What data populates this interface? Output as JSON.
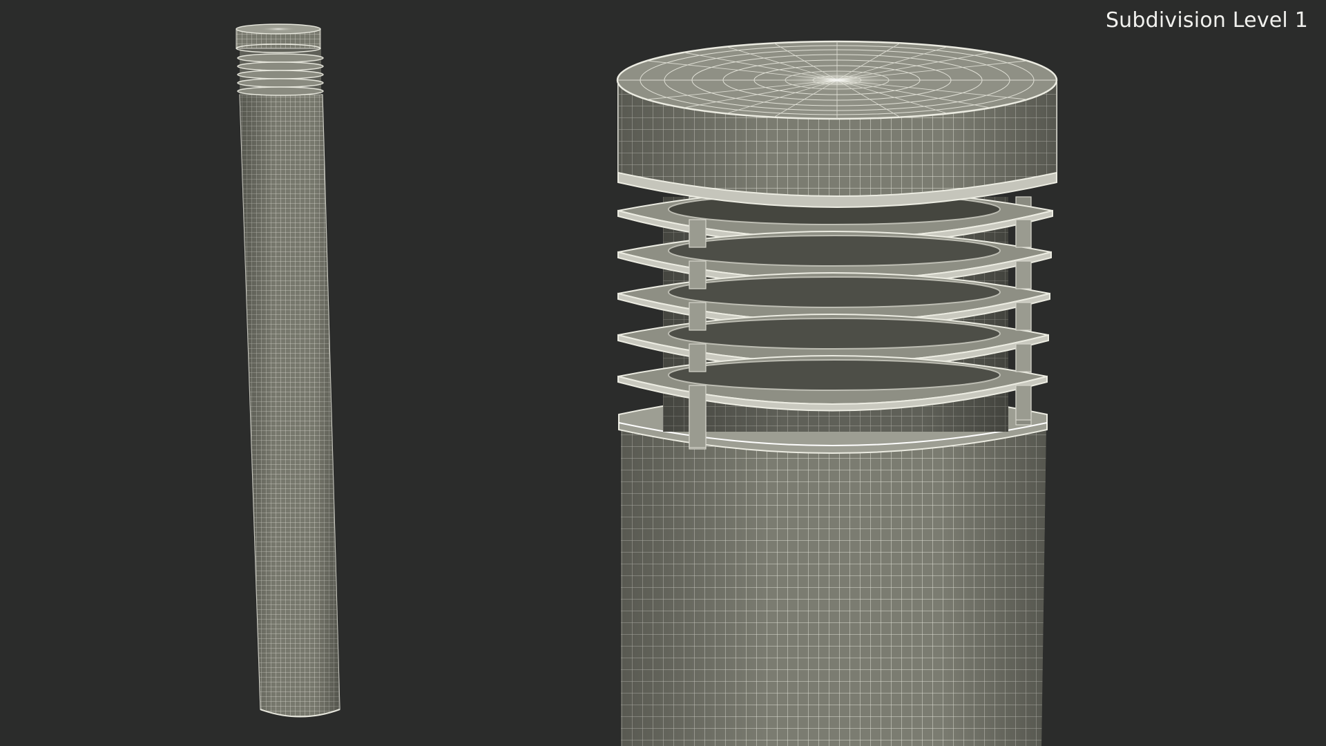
{
  "overlay": {
    "subdivision_label": "Subdivision Level 1"
  },
  "colors": {
    "background": "#2b2c2b",
    "surface": "#77786d",
    "surface_dark": "#5d5e55",
    "wire": "#d9d9cf",
    "label": "#f1f1ee"
  }
}
